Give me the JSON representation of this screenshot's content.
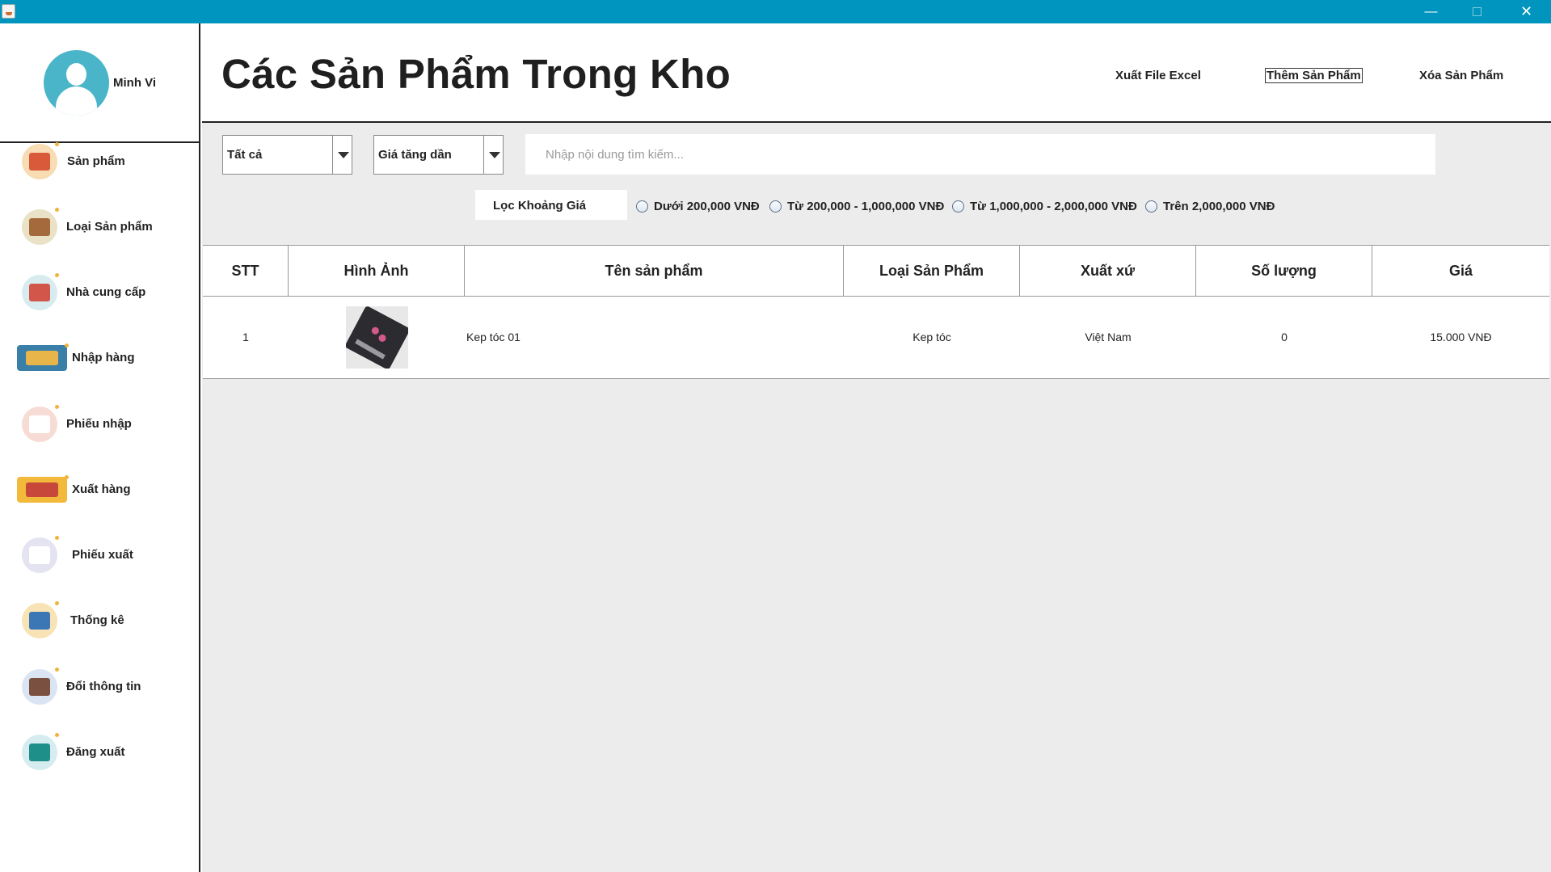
{
  "window": {
    "minimize": "—",
    "maximize": "",
    "close": "✕"
  },
  "profile": {
    "name": "Minh Vi"
  },
  "sidebar": {
    "items": [
      {
        "label": "Sản phẩm",
        "icon": "basket-icon",
        "color": "#f7dcb4",
        "glyph": "#d95a3a"
      },
      {
        "label": "Loại Sản phẩm",
        "icon": "box-icon",
        "color": "#e9e2c6",
        "glyph": "#a56a3c"
      },
      {
        "label": "Nhà cung cấp",
        "icon": "store-icon",
        "color": "#d8ecef",
        "glyph": "#d2564a"
      },
      {
        "label": "Nhập hàng",
        "icon": "truck-icon",
        "color": "#3a7fa8",
        "glyph": "#e8b54a"
      },
      {
        "label": "Phiếu nhập",
        "icon": "receipt-icon",
        "color": "#f6dcd4",
        "glyph": "#ffffff"
      },
      {
        "label": "Xuất hàng",
        "icon": "delivery-truck-icon",
        "color": "#f2b93a",
        "glyph": "#c7473a"
      },
      {
        "label": "Phiếu xuất",
        "icon": "invoice-icon",
        "color": "#e3e3f2",
        "glyph": "#ffffff"
      },
      {
        "label": "Thống kê",
        "icon": "chart-icon",
        "color": "#f7e3b5",
        "glyph": "#3b77b5"
      },
      {
        "label": "Đổi thông tin",
        "icon": "user-edit-icon",
        "color": "#dbe4f2",
        "glyph": "#7a5040"
      },
      {
        "label": "Đăng xuất",
        "icon": "logout-icon",
        "color": "#d6ecef",
        "glyph": "#1f8f8a"
      }
    ]
  },
  "header": {
    "title": "Các Sản Phẩm Trong Kho",
    "export_excel": "Xuất File Excel",
    "add_product": "Thêm Sản Phẩm",
    "delete_product": "Xóa Sản Phẩm"
  },
  "filters": {
    "category_selected": "Tất cả",
    "sort_selected": "Giá tăng dần",
    "search_placeholder": "Nhập nội dung tìm kiếm...",
    "price_filter_label": "Lọc Khoảng Giá",
    "price_ranges": [
      "Dưới 200,000 VNĐ",
      "Từ 200,000 - 1,000,000 VNĐ",
      "Từ 1,000,000 - 2,000,000 VNĐ",
      "Trên 2,000,000 VNĐ"
    ]
  },
  "table": {
    "columns": [
      "STT",
      "Hình Ảnh",
      "Tên sản phẩm",
      "Loại Sản Phẩm",
      "Xuất xứ",
      "Số lượng",
      "Giá"
    ],
    "rows": [
      {
        "stt": "1",
        "image": "hair-clip-product-image",
        "name": "Kep tóc 01",
        "category": "Kep tóc",
        "origin": "Việt Nam",
        "quantity": "0",
        "price": "15.000 VNĐ"
      }
    ]
  },
  "colors": {
    "titlebar": "#0095bf",
    "avatar": "#4ab5c9",
    "content_bg": "#ececec"
  }
}
